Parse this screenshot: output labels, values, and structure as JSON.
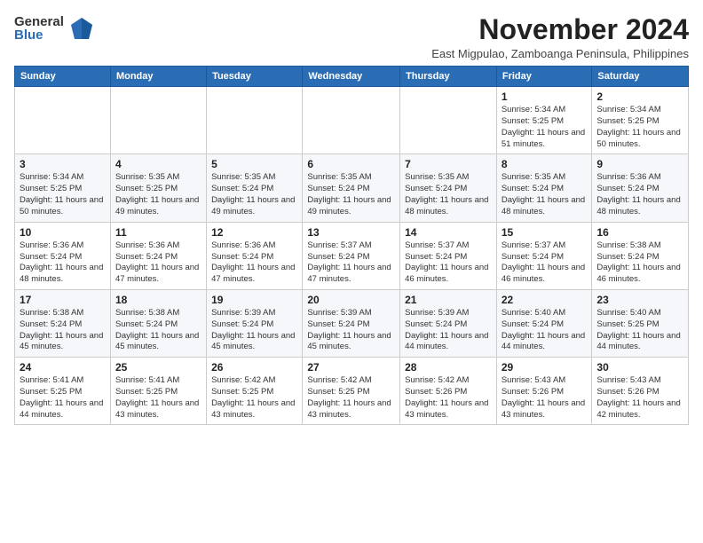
{
  "logo": {
    "general": "General",
    "blue": "Blue"
  },
  "title": "November 2024",
  "subtitle": "East Migpulao, Zamboanga Peninsula, Philippines",
  "weekdays": [
    "Sunday",
    "Monday",
    "Tuesday",
    "Wednesday",
    "Thursday",
    "Friday",
    "Saturday"
  ],
  "weeks": [
    [
      {
        "day": "",
        "info": ""
      },
      {
        "day": "",
        "info": ""
      },
      {
        "day": "",
        "info": ""
      },
      {
        "day": "",
        "info": ""
      },
      {
        "day": "",
        "info": ""
      },
      {
        "day": "1",
        "info": "Sunrise: 5:34 AM\nSunset: 5:25 PM\nDaylight: 11 hours and 51 minutes."
      },
      {
        "day": "2",
        "info": "Sunrise: 5:34 AM\nSunset: 5:25 PM\nDaylight: 11 hours and 50 minutes."
      }
    ],
    [
      {
        "day": "3",
        "info": "Sunrise: 5:34 AM\nSunset: 5:25 PM\nDaylight: 11 hours and 50 minutes."
      },
      {
        "day": "4",
        "info": "Sunrise: 5:35 AM\nSunset: 5:25 PM\nDaylight: 11 hours and 49 minutes."
      },
      {
        "day": "5",
        "info": "Sunrise: 5:35 AM\nSunset: 5:24 PM\nDaylight: 11 hours and 49 minutes."
      },
      {
        "day": "6",
        "info": "Sunrise: 5:35 AM\nSunset: 5:24 PM\nDaylight: 11 hours and 49 minutes."
      },
      {
        "day": "7",
        "info": "Sunrise: 5:35 AM\nSunset: 5:24 PM\nDaylight: 11 hours and 48 minutes."
      },
      {
        "day": "8",
        "info": "Sunrise: 5:35 AM\nSunset: 5:24 PM\nDaylight: 11 hours and 48 minutes."
      },
      {
        "day": "9",
        "info": "Sunrise: 5:36 AM\nSunset: 5:24 PM\nDaylight: 11 hours and 48 minutes."
      }
    ],
    [
      {
        "day": "10",
        "info": "Sunrise: 5:36 AM\nSunset: 5:24 PM\nDaylight: 11 hours and 48 minutes."
      },
      {
        "day": "11",
        "info": "Sunrise: 5:36 AM\nSunset: 5:24 PM\nDaylight: 11 hours and 47 minutes."
      },
      {
        "day": "12",
        "info": "Sunrise: 5:36 AM\nSunset: 5:24 PM\nDaylight: 11 hours and 47 minutes."
      },
      {
        "day": "13",
        "info": "Sunrise: 5:37 AM\nSunset: 5:24 PM\nDaylight: 11 hours and 47 minutes."
      },
      {
        "day": "14",
        "info": "Sunrise: 5:37 AM\nSunset: 5:24 PM\nDaylight: 11 hours and 46 minutes."
      },
      {
        "day": "15",
        "info": "Sunrise: 5:37 AM\nSunset: 5:24 PM\nDaylight: 11 hours and 46 minutes."
      },
      {
        "day": "16",
        "info": "Sunrise: 5:38 AM\nSunset: 5:24 PM\nDaylight: 11 hours and 46 minutes."
      }
    ],
    [
      {
        "day": "17",
        "info": "Sunrise: 5:38 AM\nSunset: 5:24 PM\nDaylight: 11 hours and 45 minutes."
      },
      {
        "day": "18",
        "info": "Sunrise: 5:38 AM\nSunset: 5:24 PM\nDaylight: 11 hours and 45 minutes."
      },
      {
        "day": "19",
        "info": "Sunrise: 5:39 AM\nSunset: 5:24 PM\nDaylight: 11 hours and 45 minutes."
      },
      {
        "day": "20",
        "info": "Sunrise: 5:39 AM\nSunset: 5:24 PM\nDaylight: 11 hours and 45 minutes."
      },
      {
        "day": "21",
        "info": "Sunrise: 5:39 AM\nSunset: 5:24 PM\nDaylight: 11 hours and 44 minutes."
      },
      {
        "day": "22",
        "info": "Sunrise: 5:40 AM\nSunset: 5:24 PM\nDaylight: 11 hours and 44 minutes."
      },
      {
        "day": "23",
        "info": "Sunrise: 5:40 AM\nSunset: 5:25 PM\nDaylight: 11 hours and 44 minutes."
      }
    ],
    [
      {
        "day": "24",
        "info": "Sunrise: 5:41 AM\nSunset: 5:25 PM\nDaylight: 11 hours and 44 minutes."
      },
      {
        "day": "25",
        "info": "Sunrise: 5:41 AM\nSunset: 5:25 PM\nDaylight: 11 hours and 43 minutes."
      },
      {
        "day": "26",
        "info": "Sunrise: 5:42 AM\nSunset: 5:25 PM\nDaylight: 11 hours and 43 minutes."
      },
      {
        "day": "27",
        "info": "Sunrise: 5:42 AM\nSunset: 5:25 PM\nDaylight: 11 hours and 43 minutes."
      },
      {
        "day": "28",
        "info": "Sunrise: 5:42 AM\nSunset: 5:26 PM\nDaylight: 11 hours and 43 minutes."
      },
      {
        "day": "29",
        "info": "Sunrise: 5:43 AM\nSunset: 5:26 PM\nDaylight: 11 hours and 43 minutes."
      },
      {
        "day": "30",
        "info": "Sunrise: 5:43 AM\nSunset: 5:26 PM\nDaylight: 11 hours and 42 minutes."
      }
    ]
  ]
}
